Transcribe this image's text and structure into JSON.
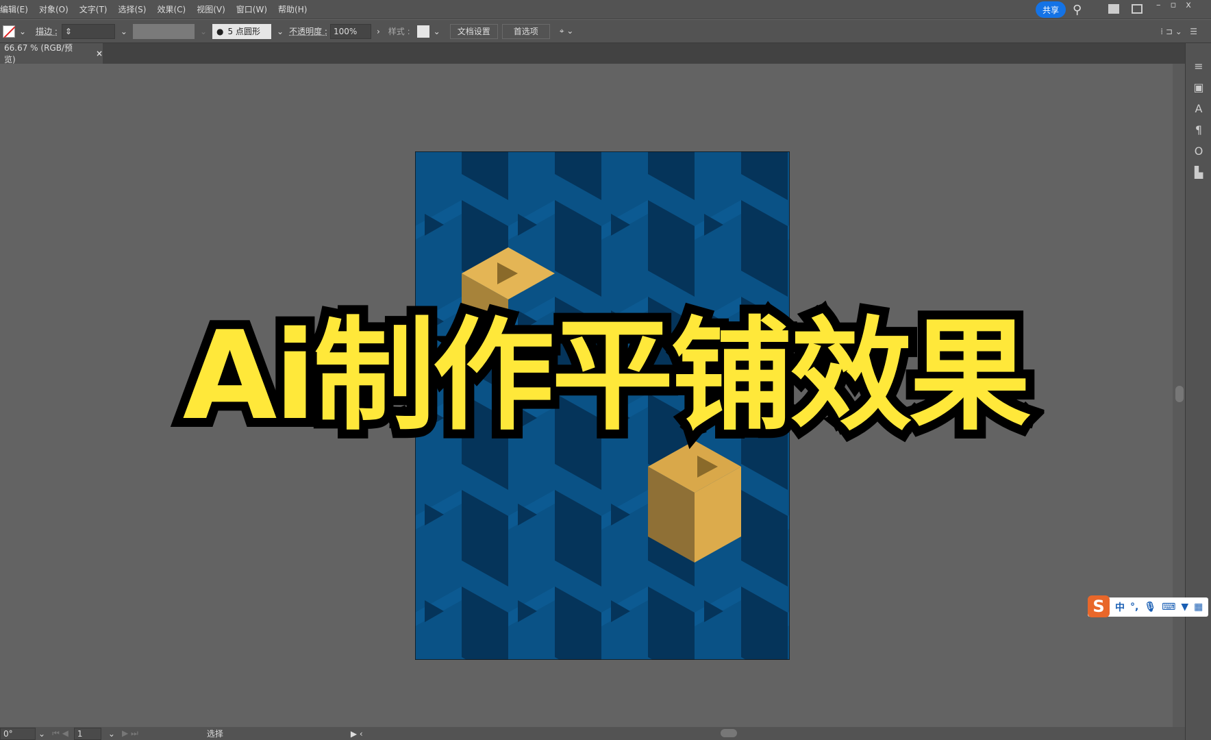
{
  "menu": [
    "编辑(E)",
    "对象(O)",
    "文字(T)",
    "选择(S)",
    "效果(C)",
    "视图(V)",
    "窗口(W)",
    "帮助(H)"
  ],
  "header": {
    "share": "共享"
  },
  "toolbar": {
    "stroke_label": "描边 :",
    "brush": "5 点圆形",
    "opacity_label": "不透明度 :",
    "opacity": "100%",
    "style_label": "样式 :",
    "doc_setup": "文档设置",
    "prefs": "首选项"
  },
  "tab": {
    "label": "66.67 % (RGB/预览)",
    "close": "×"
  },
  "status": {
    "rotation": "0°",
    "page": "1",
    "tool": "选择"
  },
  "title": "Ai制作平铺效果",
  "ime": {
    "logo": "S",
    "mode": "中",
    "punct": "°,"
  },
  "colors": {
    "blue_light": "#0a5286",
    "blue_dark": "#05345a",
    "gold": "#d9a84a",
    "title_yellow": "#ffe83a",
    "accent": "#1473e6"
  }
}
